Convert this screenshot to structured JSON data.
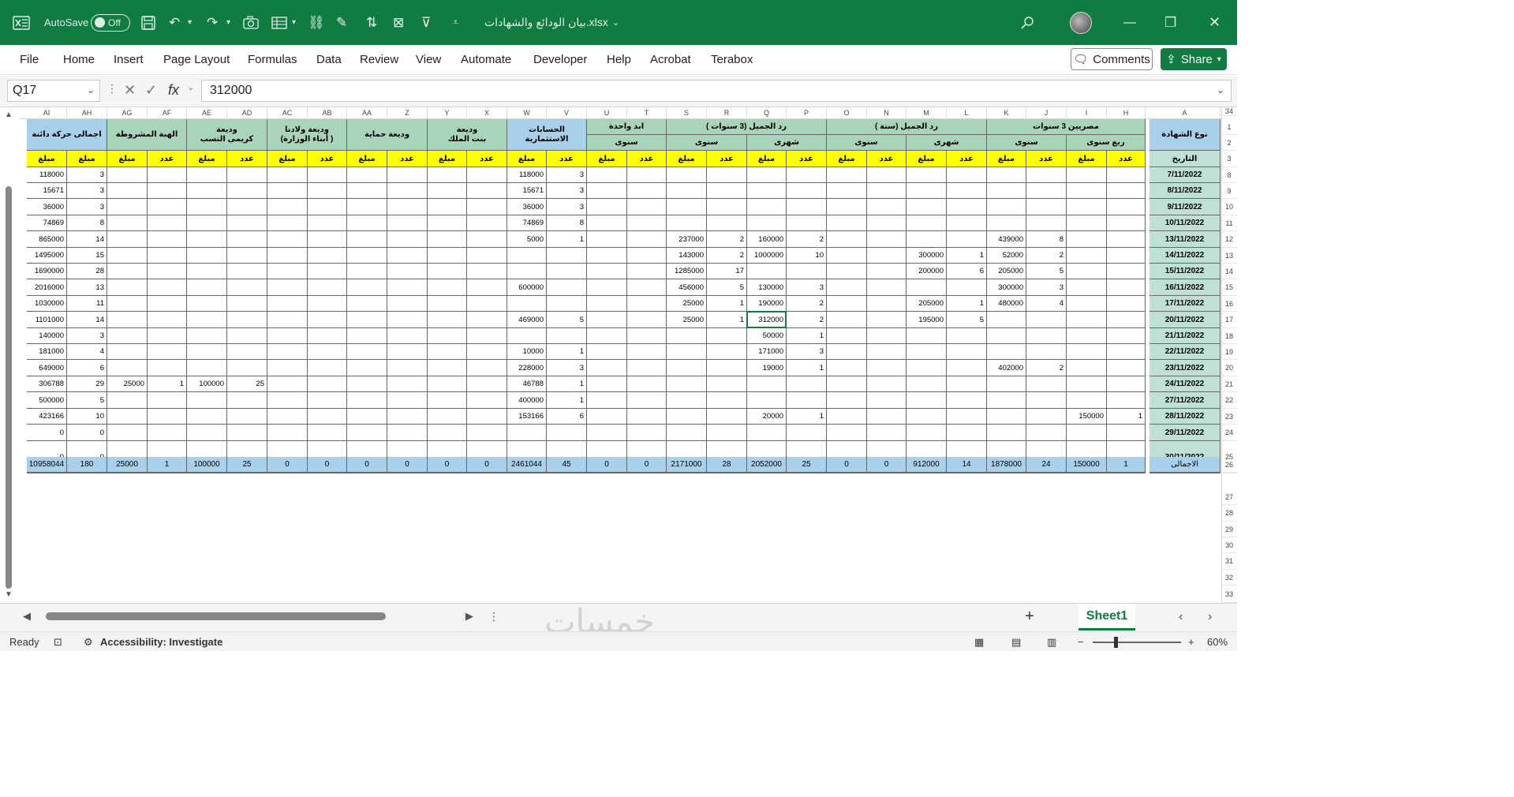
{
  "titlebar": {
    "autosave_label": "AutoSave",
    "autosave_state": "Off",
    "filename": "بيان الودائع والشهادات.xlsx",
    "colors": {
      "brand": "#107c41"
    }
  },
  "ribbon": {
    "tabs": [
      "File",
      "Home",
      "Insert",
      "Page Layout",
      "Formulas",
      "Data",
      "Review",
      "View",
      "Automate",
      "Developer",
      "Help",
      "Acrobat",
      "Terabox"
    ],
    "comments_label": "Comments",
    "share_label": "Share"
  },
  "formula_bar": {
    "name_box": "Q17",
    "fx": "fx",
    "value": "312000"
  },
  "columns": [
    "AI",
    "AH",
    "AG",
    "AF",
    "AE",
    "AD",
    "AC",
    "AB",
    "AA",
    "Z",
    "Y",
    "X",
    "W",
    "V",
    "U",
    "T",
    "S",
    "R",
    "Q",
    "P",
    "O",
    "N",
    "M",
    "L",
    "K",
    "J",
    "I",
    "H",
    "A"
  ],
  "rows": [
    "1",
    "2",
    "3",
    "8",
    "9",
    "10",
    "11",
    "12",
    "13",
    "14",
    "15",
    "16",
    "17",
    "18",
    "19",
    "20",
    "21",
    "22",
    "23",
    "24",
    "25",
    "26",
    "27",
    "28",
    "29",
    "30",
    "31",
    "32",
    "33",
    "34"
  ],
  "headers": {
    "total_movement": "اجمالى حركة دائنة",
    "conditional_grant": "الهبة المشروطة",
    "deposit_kareemy": "وديعة\nكريمى النسب",
    "deposit_awladna": "وديعة ولادنا\n(أبناء الوزارة )",
    "deposit_himaya": "وديعة حماية",
    "deposit_bent": "وديعة\nبنت الملك",
    "investment_accounts": "الحسابات الاستثمارية",
    "aid_wahda": "ابد واحدة",
    "rad_3y": "رد الجميل (3 سنوات )",
    "rad_1y": "رد الجميل (سنة )",
    "masrieen": "مصريين 3 سنوات",
    "cert_type": "نوع الشهادة",
    "annual": "سنوى",
    "monthly": "شهرى",
    "quarterly": "ربع سنوى",
    "date": "التاريخ",
    "amount": "مبلغ",
    "count": "عدد",
    "total_label": "الاجمالى"
  },
  "dates": [
    "7/11/2022",
    "8/11/2022",
    "9/11/2022",
    "10/11/2022",
    "13/11/2022",
    "14/11/2022",
    "15/11/2022",
    "16/11/2022",
    "17/11/2022",
    "20/11/2022",
    "21/11/2022",
    "22/11/2022",
    "23/11/2022",
    "24/11/2022",
    "27/11/2022",
    "28/11/2022",
    "29/11/2022",
    "30/11/2022"
  ],
  "table_rows": [
    {
      "AI": "118000",
      "AH": "3",
      "W": "118000",
      "V": "3"
    },
    {
      "AI": "15671",
      "AH": "3",
      "W": "15671",
      "V": "3"
    },
    {
      "AI": "36000",
      "AH": "3",
      "W": "36000",
      "V": "3"
    },
    {
      "AI": "74869",
      "AH": "8",
      "W": "74869",
      "V": "8"
    },
    {
      "AI": "865000",
      "AH": "14",
      "W": "5000",
      "V": "1",
      "S": "237000",
      "R": "2",
      "Q": "160000",
      "P": "2",
      "K": "439000",
      "J": "8"
    },
    {
      "AI": "1495000",
      "AH": "15",
      "S": "143000",
      "R": "2",
      "Q": "1000000",
      "P": "10",
      "M": "300000",
      "L": "1",
      "K": "52000",
      "J": "2"
    },
    {
      "AI": "1690000",
      "AH": "28",
      "S": "1285000",
      "R": "17",
      "M": "200000",
      "L": "6",
      "K": "205000",
      "J": "5"
    },
    {
      "AI": "2016000",
      "AH": "13",
      "W": "600000",
      "S": "456000",
      "R": "5",
      "Q": "130000",
      "P": "3",
      "K": "300000",
      "J": "3"
    },
    {
      "AI": "1030000",
      "AH": "11",
      "S": "25000",
      "R": "1",
      "Q": "190000",
      "P": "2",
      "M": "205000",
      "L": "1",
      "K": "480000",
      "J": "4"
    },
    {
      "AI": "1101000",
      "AH": "14",
      "W": "469000",
      "V": "5",
      "S": "25000",
      "R": "1",
      "Q": "312000",
      "P": "2",
      "M": "195000",
      "L": "5"
    },
    {
      "AI": "140000",
      "AH": "3",
      "Q": "50000",
      "P": "1"
    },
    {
      "AI": "181000",
      "AH": "4",
      "W": "10000",
      "V": "1",
      "Q": "171000",
      "P": "3"
    },
    {
      "AI": "649000",
      "AH": "6",
      "W": "228000",
      "V": "3",
      "Q": "19000",
      "P": "1",
      "K": "402000",
      "J": "2"
    },
    {
      "AI": "306788",
      "AH": "29",
      "AG": "25000",
      "AF": "1",
      "AE": "100000",
      "AD": "25",
      "W": "46788",
      "V": "1"
    },
    {
      "AI": "500000",
      "AH": "5",
      "W": "400000",
      "V": "1"
    },
    {
      "AI": "423166",
      "AH": "10",
      "W": "153166",
      "V": "6",
      "Q": "20000",
      "P": "1",
      "I": "150000",
      "H": "1"
    },
    {
      "AI": "0",
      "AH": "0"
    },
    {
      "AI": "0",
      "AH": "0"
    }
  ],
  "totals": {
    "AI": "10958044",
    "AH": "180",
    "AG": "25000",
    "AF": "1",
    "AE": "100000",
    "AD": "25",
    "AC": "0",
    "AB": "0",
    "AA": "0",
    "Z": "0",
    "Y": "0",
    "X": "0",
    "W": "2461044",
    "V": "45",
    "U": "0",
    "T": "0",
    "S": "2171000",
    "R": "28",
    "Q": "2052000",
    "P": "25",
    "O": "0",
    "N": "0",
    "M": "912000",
    "L": "14",
    "K": "1878000",
    "J": "24",
    "I": "150000",
    "H": "1"
  },
  "sheet_tabs": {
    "active": "Sheet1"
  },
  "status_bar": {
    "ready": "Ready",
    "accessibility": "Accessibility: Investigate",
    "zoom": "60%"
  },
  "watermark": "خمسات",
  "icons": {
    "excel": "excel-icon",
    "save": "save-icon",
    "undo": "undo-icon",
    "redo": "redo-icon",
    "search": "search-icon",
    "close": "close-icon",
    "restore": "restore-icon",
    "minimize": "minimize-icon"
  }
}
